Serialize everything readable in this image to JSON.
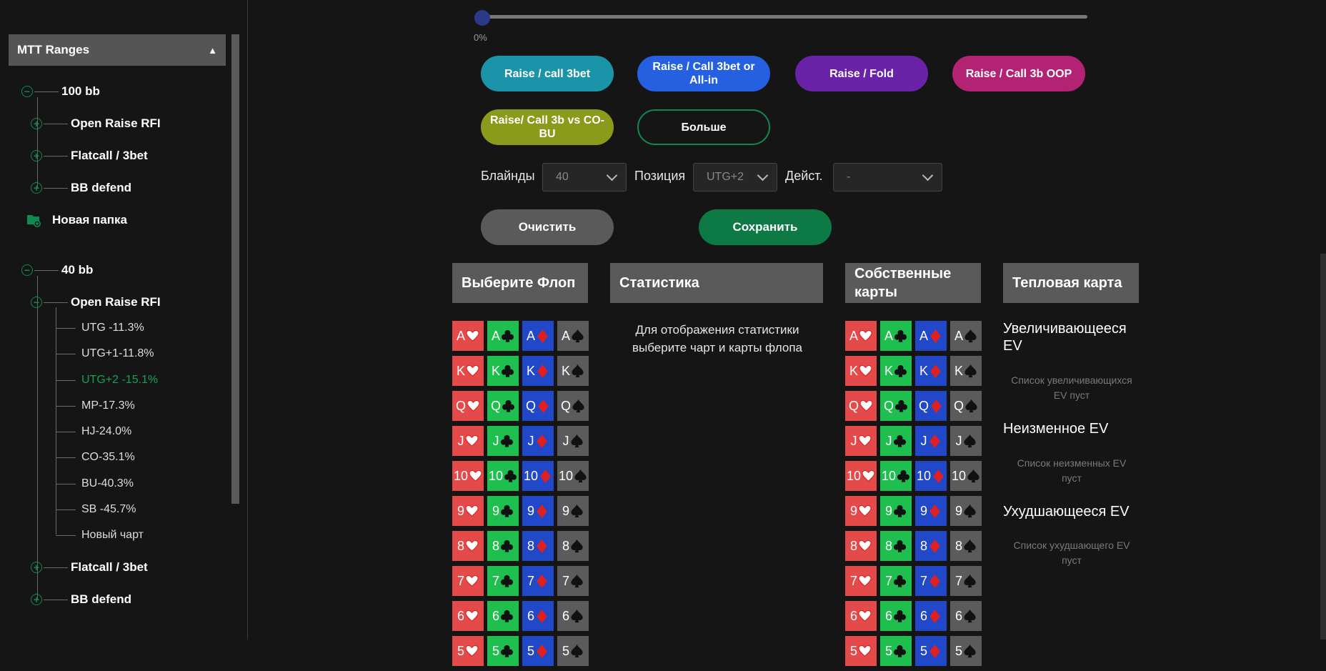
{
  "sidebar": {
    "title": "MTT Ranges",
    "collapse_icon": "triangle-up-icon",
    "groups": [
      {
        "label": "100 bb",
        "items": [
          "Open Raise RFI",
          "Flatcall / 3bet",
          "BB defend"
        ],
        "new_folder": "Новая папка"
      },
      {
        "label": "40 bb",
        "open_item": "Open Raise RFI",
        "charts": [
          "UTG -11.3%",
          "UTG+1-11.8%",
          "UTG+2 -15.1%",
          "MP-17.3%",
          "HJ-24.0%",
          "CO-35.1%",
          "BU-40.3%",
          "SB -45.7%",
          "Новый чарт"
        ],
        "active_chart": "UTG+2 -15.1%",
        "items": [
          "Flatcall / 3bet",
          "BB defend"
        ]
      }
    ]
  },
  "slider": {
    "value_label": "0%",
    "value": 0
  },
  "actions": [
    {
      "label": "Raise / call 3bet",
      "color": "#1b93a8"
    },
    {
      "label": "Raise / Call 3bet or All-in",
      "color": "#2460e0"
    },
    {
      "label": "Raise / Fold",
      "color": "#6a22a8"
    },
    {
      "label": "Raise / Call 3b OOP",
      "color": "#b32374"
    },
    {
      "label": "Raise/ Call 3b vs CO-BU",
      "color": "#8a9a1a"
    },
    {
      "label": "Больше",
      "color": "#151515",
      "border": "#0f8a50"
    }
  ],
  "filters": {
    "blinds_label": "Блайнды",
    "blinds_value": "40",
    "position_label": "Позиция",
    "position_value": "UTG+2",
    "action_label": "Дейст.",
    "action_value": "-"
  },
  "buttons": {
    "clear": "Очистить",
    "save": "Сохранить",
    "clear_color": "#5a5a5a",
    "save_color": "#0d7a46"
  },
  "panels": {
    "flop": {
      "title": "Выберите Флоп"
    },
    "stats": {
      "title": "Статистика",
      "message_line1": "Для отображения статистики",
      "message_line2": "выберите чарт и карты флопа"
    },
    "own": {
      "title_line1": "Собственные",
      "title_line2": "карты"
    },
    "heat": {
      "title": "Тепловая карта",
      "increasing_line1": "Увеличивающееся",
      "increasing_line2": "EV",
      "increasing_empty_line1": "Список увеличивающихся",
      "increasing_empty_line2": "EV пуст",
      "unchanged": "Неизменное EV",
      "unchanged_empty_line1": "Список неизменных EV",
      "unchanged_empty_line2": "пуст",
      "decreasing": "Ухудшающееся EV",
      "decreasing_empty_line1": "Список ухудшающего EV",
      "decreasing_empty_line2": "пуст"
    }
  },
  "cards": {
    "ranks": [
      "A",
      "K",
      "Q",
      "J",
      "10",
      "9",
      "8",
      "7",
      "6",
      "5"
    ],
    "suits": [
      {
        "name": "hearts",
        "icon": "heart-icon",
        "bg": "#e44a4a",
        "glyph": "#ffffff",
        "stroke": "#e02020"
      },
      {
        "name": "clubs",
        "icon": "club-icon",
        "bg": "#1fbf4f",
        "glyph": "#111111",
        "stroke": "#111111"
      },
      {
        "name": "diamonds",
        "icon": "diamond-icon",
        "bg": "#2148c8",
        "glyph": "#e02020",
        "stroke": "#e02020"
      },
      {
        "name": "spades",
        "icon": "spade-icon",
        "bg": "#5b5b5b",
        "glyph": "#111111",
        "stroke": "#111111"
      }
    ]
  }
}
